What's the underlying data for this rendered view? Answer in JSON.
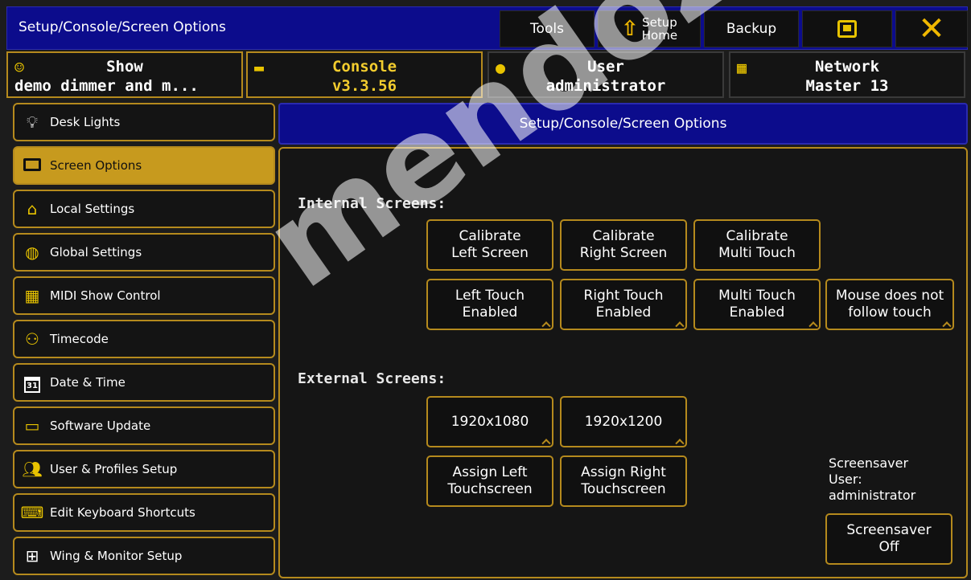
{
  "titlebar": {
    "title": "Setup/Console/Screen Options",
    "tools_label": "Tools",
    "setup_home_label": "Setup\nHome",
    "backup_label": "Backup"
  },
  "status_tabs": {
    "show": {
      "line1": "Show",
      "line2": "demo dimmer and m..."
    },
    "console": {
      "line1": "Console",
      "line2": "v3.3.56"
    },
    "user": {
      "line1": "User",
      "line2": "administrator"
    },
    "network": {
      "line1": "Network",
      "line2": "Master 13"
    }
  },
  "sidebar": {
    "items": [
      {
        "label": "Desk Lights",
        "icon": "lightbulb-icon"
      },
      {
        "label": "Screen Options",
        "icon": "monitor-icon"
      },
      {
        "label": "Local Settings",
        "icon": "home-icon"
      },
      {
        "label": "Global Settings",
        "icon": "globe-icon"
      },
      {
        "label": "MIDI Show Control",
        "icon": "midi-icon"
      },
      {
        "label": "Timecode",
        "icon": "timecode-icon"
      },
      {
        "label": "Date & Time",
        "icon": "calendar-icon"
      },
      {
        "label": "Software Update",
        "icon": "usb-icon"
      },
      {
        "label": "User & Profiles Setup",
        "icon": "users-icon"
      },
      {
        "label": "Edit Keyboard Shortcuts",
        "icon": "keyboard-icon"
      },
      {
        "label": "Wing & Monitor Setup",
        "icon": "wing-icon"
      }
    ],
    "calendar_icon_text": "31"
  },
  "panel": {
    "header": "Setup/Console/Screen Options",
    "internal_heading": "Internal Screens:",
    "external_heading": "External Screens:",
    "internal_row1": [
      "Calibrate\nLeft Screen",
      "Calibrate\nRight Screen",
      "Calibrate\nMulti Touch"
    ],
    "internal_row2": [
      "Left Touch\nEnabled",
      "Right Touch\nEnabled",
      "Multi Touch\nEnabled",
      "Mouse does not\nfollow touch"
    ],
    "external_row1": [
      "1920x1080",
      "1920x1200"
    ],
    "external_row2": [
      "Assign Left\nTouchscreen",
      "Assign Right\nTouchscreen"
    ],
    "screensaver_info": "Screensaver\nUser:\nadministrator",
    "screensaver_button": "Screensaver\nOff"
  },
  "watermark": "mendoza.com",
  "colors": {
    "title_blue": "#0c0c8c",
    "accent_gold": "#b58a1d",
    "active_gold": "#c79a1e",
    "icon_yellow": "#e8c300"
  }
}
